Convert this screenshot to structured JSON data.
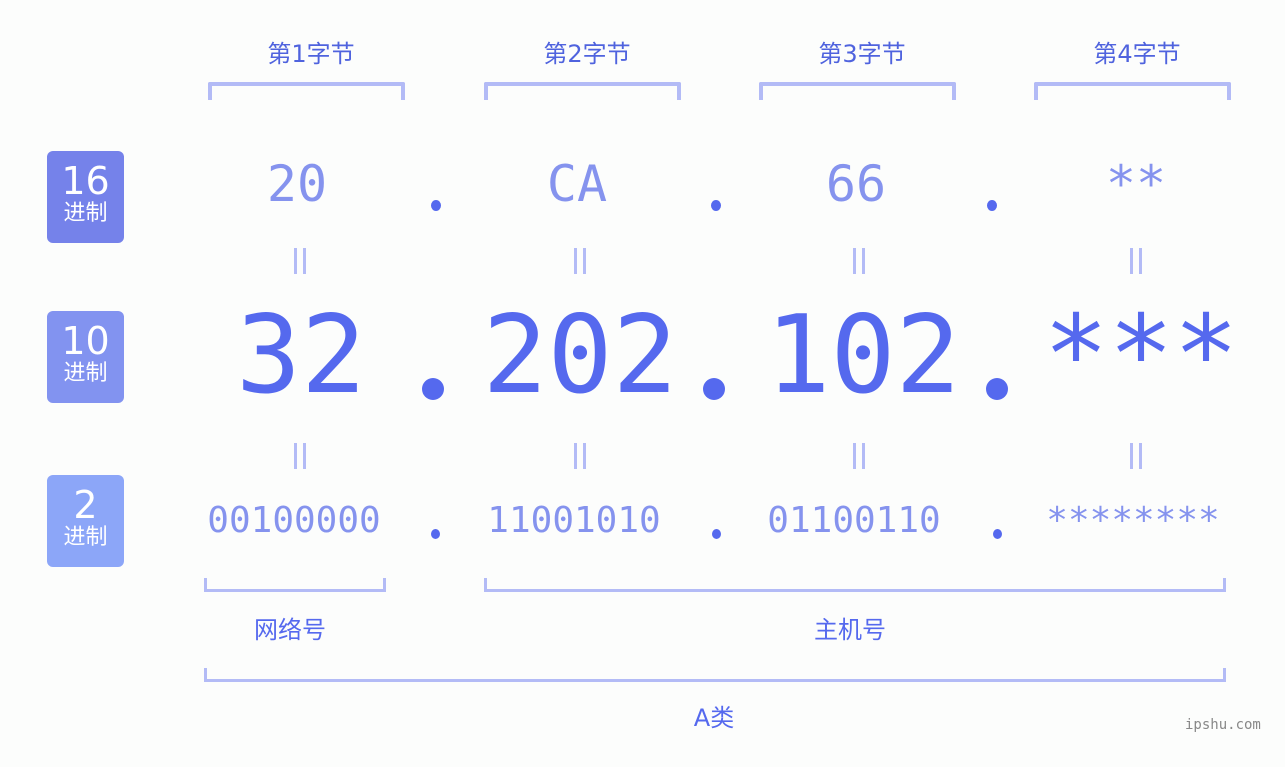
{
  "bytes": [
    {
      "label": "第1字节",
      "hex": "20",
      "decimal": "32",
      "binary": "00100000"
    },
    {
      "label": "第2字节",
      "hex": "CA",
      "decimal": "202",
      "binary": "11001010"
    },
    {
      "label": "第3字节",
      "hex": "66",
      "decimal": "102",
      "binary": "01100110"
    },
    {
      "label": "第4字节",
      "hex": "**",
      "decimal": "***",
      "binary": "********"
    }
  ],
  "separator": ".",
  "rows": {
    "hex": {
      "number": "16",
      "unit": "进制",
      "color": "#7582ea"
    },
    "decimal": {
      "number": "10",
      "unit": "进制",
      "color": "#8293f0"
    },
    "binary": {
      "number": "2",
      "unit": "进制",
      "color": "#8ca6f8"
    }
  },
  "segments": {
    "network": "网络号",
    "host": "主机号",
    "class": "A类"
  },
  "watermark": "ipshu.com",
  "colors": {
    "accent": "#5569ee",
    "light_accent": "#8593ee",
    "bracket": "#b3bbf6"
  }
}
